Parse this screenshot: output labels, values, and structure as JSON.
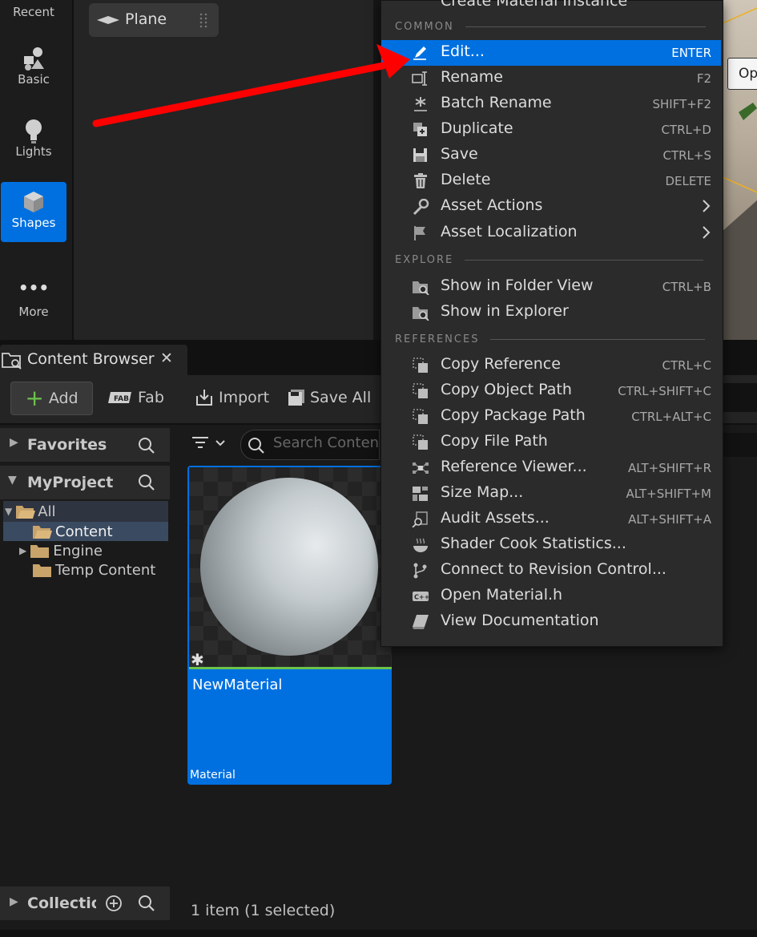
{
  "placement_panel": {
    "categories": [
      {
        "label": "Recent",
        "icon": "clock-icon"
      },
      {
        "label": "Basic",
        "icon": "basic-shapes-icon"
      },
      {
        "label": "Lights",
        "icon": "lightbulb-icon"
      },
      {
        "label": "Shapes",
        "icon": "cube-icon",
        "active": true
      },
      {
        "label": "More",
        "icon": "ellipsis-icon"
      }
    ],
    "selected_item": "Plane"
  },
  "viewport": {
    "button_partial": "Op"
  },
  "content_browser": {
    "tab_title": "Content Browser",
    "toolbar": {
      "add_label": "Add",
      "fab_label": "Fab",
      "import_label": "Import",
      "save_all_label": "Save All"
    },
    "sources": {
      "favorites_label": "Favorites",
      "project_label": "MyProject",
      "tree": [
        {
          "label": "All",
          "level": 0
        },
        {
          "label": "Content",
          "level": 1,
          "selected": true
        },
        {
          "label": "Engine",
          "level": 1
        },
        {
          "label": "Temp Content",
          "level": 1
        }
      ],
      "collections_label": "Collection"
    },
    "search_placeholder": "Search Content",
    "asset": {
      "name": "NewMaterial",
      "type": "Material"
    },
    "status": "1 item (1 selected)"
  },
  "context_menu": {
    "top_item": "Create Material Instance",
    "sections": {
      "common": "COMMON",
      "explore": "EXPLORE",
      "references": "REFERENCES"
    },
    "common_items": [
      {
        "label": "Edit...",
        "shortcut": "ENTER",
        "icon": "pencil-icon",
        "highlighted": true
      },
      {
        "label": "Rename",
        "shortcut": "F2",
        "icon": "rename-icon"
      },
      {
        "label": "Batch Rename",
        "shortcut": "SHIFT+F2",
        "icon": "asterisk-icon"
      },
      {
        "label": "Duplicate",
        "shortcut": "CTRL+D",
        "icon": "duplicate-icon"
      },
      {
        "label": "Save",
        "shortcut": "CTRL+S",
        "icon": "floppy-icon"
      },
      {
        "label": "Delete",
        "shortcut": "DELETE",
        "icon": "trash-icon"
      },
      {
        "label": "Asset Actions",
        "shortcut": "",
        "icon": "wrench-icon",
        "submenu": true
      },
      {
        "label": "Asset Localization",
        "shortcut": "",
        "icon": "flag-icon",
        "submenu": true
      }
    ],
    "explore_items": [
      {
        "label": "Show in Folder View",
        "shortcut": "CTRL+B",
        "icon": "folder-search-icon"
      },
      {
        "label": "Show in Explorer",
        "shortcut": "",
        "icon": "folder-search-icon"
      }
    ],
    "reference_items": [
      {
        "label": "Copy Reference",
        "shortcut": "CTRL+C",
        "icon": "copy-icon"
      },
      {
        "label": "Copy Object Path",
        "shortcut": "CTRL+SHIFT+C",
        "icon": "copy-icon"
      },
      {
        "label": "Copy Package Path",
        "shortcut": "CTRL+ALT+C",
        "icon": "copy-icon"
      },
      {
        "label": "Copy File Path",
        "shortcut": "",
        "icon": "copy-icon"
      },
      {
        "label": "Reference Viewer...",
        "shortcut": "ALT+SHIFT+R",
        "icon": "reference-viewer-icon"
      },
      {
        "label": "Size Map...",
        "shortcut": "ALT+SHIFT+M",
        "icon": "size-map-icon"
      },
      {
        "label": "Audit Assets...",
        "shortcut": "ALT+SHIFT+A",
        "icon": "audit-icon"
      },
      {
        "label": "Shader Cook Statistics...",
        "shortcut": "",
        "icon": "shader-cook-icon"
      },
      {
        "label": "Connect to Revision Control...",
        "shortcut": "",
        "icon": "branch-icon"
      },
      {
        "label": "Open Material.h",
        "shortcut": "",
        "icon": "cpp-file-icon"
      },
      {
        "label": "View Documentation",
        "shortcut": "",
        "icon": "book-icon"
      }
    ]
  },
  "colors": {
    "accent": "#0070e0",
    "annotation_arrow": "#ff0000",
    "folder": "#c8a36a"
  }
}
